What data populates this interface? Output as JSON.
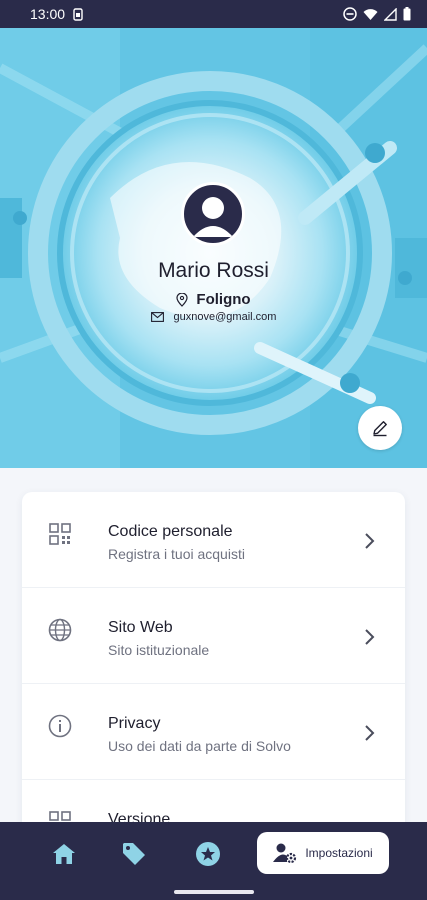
{
  "status_bar": {
    "time": "13:00"
  },
  "profile": {
    "name": "Mario Rossi",
    "location": "Foligno",
    "email": "guxnove@gmail.com"
  },
  "menu": {
    "items": [
      {
        "title": "Codice personale",
        "subtitle": "Registra i tuoi acquisti",
        "icon": "qr-code-icon"
      },
      {
        "title": "Sito Web",
        "subtitle": "Sito istituzionale",
        "icon": "globe-icon"
      },
      {
        "title": "Privacy",
        "subtitle": "Uso dei dati da parte di Solvo",
        "icon": "info-icon"
      },
      {
        "title": "Versione",
        "subtitle": "",
        "icon": "qr-code-icon"
      }
    ]
  },
  "bottom_nav": {
    "items": [
      {
        "icon": "home-icon"
      },
      {
        "icon": "tag-icon"
      },
      {
        "icon": "star-badge-icon"
      },
      {
        "icon": "user-settings-icon",
        "label": "Impostazioni",
        "active": true
      }
    ]
  },
  "colors": {
    "dark": "#2a2b4a",
    "nav_icon": "#8fd3e6",
    "hero": "#6fcfe9"
  }
}
